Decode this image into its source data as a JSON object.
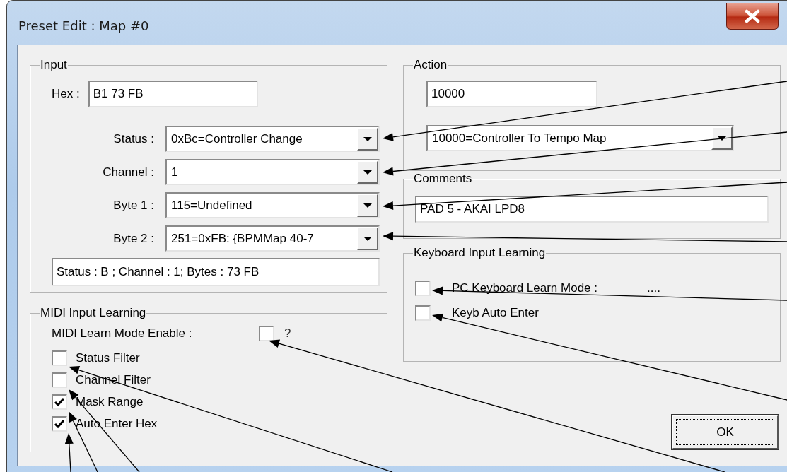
{
  "window": {
    "title": "Preset Edit : Map #0"
  },
  "input": {
    "legend": "Input",
    "hex_label": "Hex :",
    "hex": "B1 73 FB",
    "rows": [
      {
        "label": "Status :",
        "value": "0xBc=Controller Change"
      },
      {
        "label": "Channel :",
        "value": "1"
      },
      {
        "label": "Byte 1 :",
        "value": "115=Undefined"
      },
      {
        "label": "Byte 2 :",
        "value": "251=0xFB: {BPMMap 40-7"
      }
    ],
    "summary": "Status : B ; Channel : 1; Bytes : 73 FB"
  },
  "midi_learning": {
    "legend": "MIDI Input Learning",
    "enable_label": "MIDI Learn Mode Enable :",
    "enable_checked": false,
    "enable_note": "?",
    "options": [
      {
        "label": "Status Filter",
        "checked": false
      },
      {
        "label": "Channel Filter",
        "checked": false
      },
      {
        "label": "Mask Range",
        "checked": true
      },
      {
        "label": "Auto Enter Hex",
        "checked": true
      }
    ]
  },
  "action": {
    "legend": "Action",
    "code": "10000",
    "choice": "10000=Controller To Tempo Map"
  },
  "comments": {
    "legend": "Comments",
    "text": "PAD 5 - AKAI LPD8"
  },
  "keyboard_learning": {
    "legend": "Keyboard Input Learning",
    "options": [
      {
        "label": "PC Keyboard Learn Mode :",
        "checked": false,
        "value": "...."
      },
      {
        "label": "Keyb Auto Enter",
        "checked": false
      }
    ]
  },
  "buttons": [
    "OK"
  ]
}
